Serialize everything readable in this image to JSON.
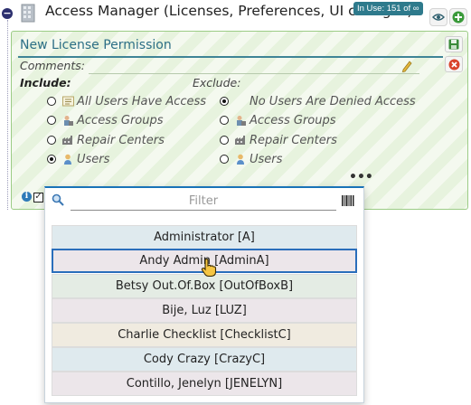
{
  "header": {
    "title": "Access Manager (Licenses, Preferences, UI changes)",
    "in_use_badge": "In Use: 151 of ∞",
    "collapse_glyph": "−"
  },
  "panel": {
    "title": "New License Permission",
    "comments_label": "Comments:",
    "comments_value": "",
    "include_label": "Include:",
    "exclude_label": "Exclude:",
    "include_options": [
      {
        "label": "All Users Have Access",
        "selected": false,
        "icon": "users-list-icon"
      },
      {
        "label": "Access Groups",
        "selected": false,
        "icon": "access-group-icon"
      },
      {
        "label": "Repair Centers",
        "selected": false,
        "icon": "factory-icon"
      },
      {
        "label": "Users",
        "selected": true,
        "icon": "user-icon"
      }
    ],
    "exclude_options": [
      {
        "label": "No Users Are Denied Access",
        "selected": true,
        "icon": ""
      },
      {
        "label": "Access Groups",
        "selected": false,
        "icon": "access-group-icon"
      },
      {
        "label": "Repair Centers",
        "selected": false,
        "icon": "factory-icon"
      },
      {
        "label": "Users",
        "selected": false,
        "icon": "user-icon"
      }
    ],
    "more_label": "•••",
    "info_glyph": "i",
    "check_glyph": "✓"
  },
  "dropdown": {
    "filter_placeholder": "Filter",
    "filter_value": "",
    "items": [
      {
        "label": "Administrator [A]",
        "color": "#dfeaee"
      },
      {
        "label": "Andy Admin [AdminA]",
        "color": "#ece6ea",
        "highlighted": true
      },
      {
        "label": "Betsy Out.Of.Box [OutOfBoxB]",
        "color": "#e4ece4"
      },
      {
        "label": "Bije, Luz [LUZ]",
        "color": "#ece6ea"
      },
      {
        "label": "Charlie Checklist [ChecklistC]",
        "color": "#f0ebe0"
      },
      {
        "label": "Cody Crazy [CrazyC]",
        "color": "#dfeaee"
      },
      {
        "label": "Contillo, Jenelyn [JENELYN]",
        "color": "#ece6ea"
      }
    ]
  },
  "colors": {
    "accent": "#2e7a8c",
    "panel_border": "#9ccc86",
    "dropdown_accent": "#1a73b8",
    "add_green": "#3a9a3a",
    "cancel_red": "#d9442b"
  }
}
